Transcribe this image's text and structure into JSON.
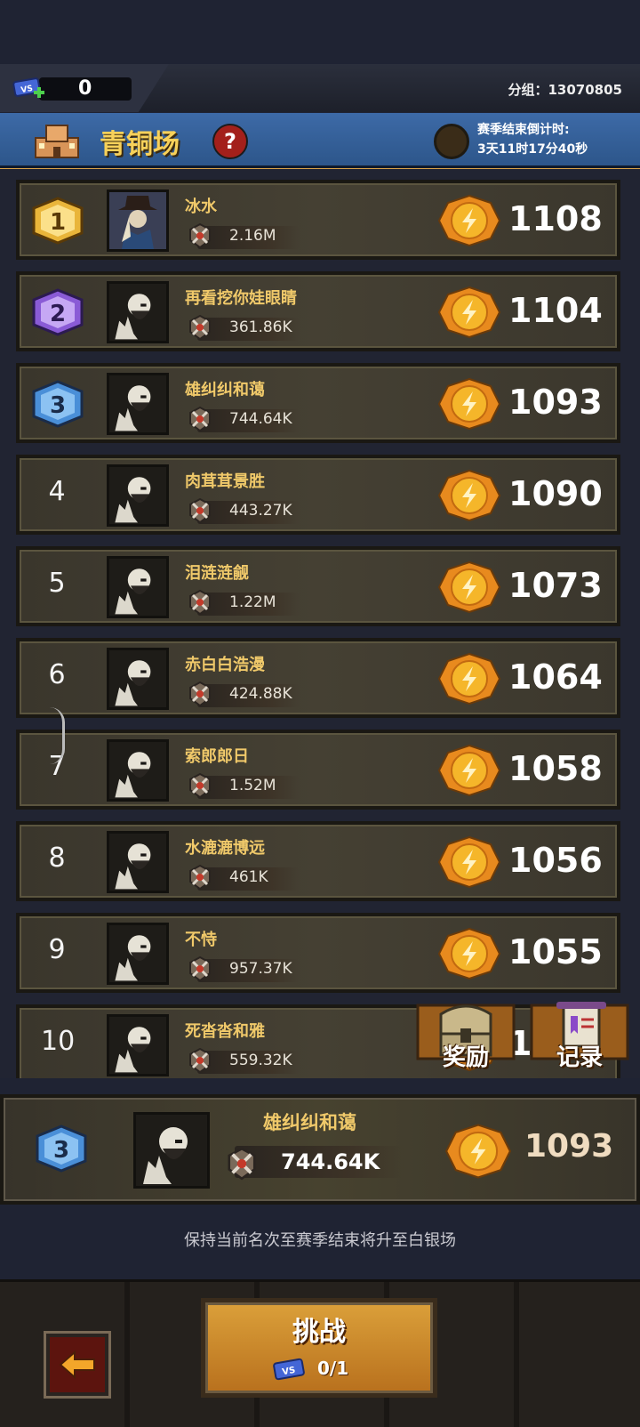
{
  "header": {
    "ticket_count": "0",
    "group_label": "分组：13070805"
  },
  "arena": {
    "title": "青铜场",
    "help": "?",
    "season_label": "赛季结束倒计时:",
    "season_countdown": "3天11时17分40秒"
  },
  "ranking": [
    {
      "rank": "1",
      "name": "冰水",
      "power": "2.16M",
      "score": "1108"
    },
    {
      "rank": "2",
      "name": "再看挖你娃眼睛",
      "power": "361.86K",
      "score": "1104"
    },
    {
      "rank": "3",
      "name": "雄纠纠和蔼",
      "power": "744.64K",
      "score": "1093"
    },
    {
      "rank": "4",
      "name": "肉茸茸景胜",
      "power": "443.27K",
      "score": "1090"
    },
    {
      "rank": "5",
      "name": "泪涟涟觎",
      "power": "1.22M",
      "score": "1073"
    },
    {
      "rank": "6",
      "name": "赤白白浩漫",
      "power": "424.88K",
      "score": "1064"
    },
    {
      "rank": "7",
      "name": "索郎郎日",
      "power": "1.52M",
      "score": "1058"
    },
    {
      "rank": "8",
      "name": "水漉漉博远",
      "power": "461K",
      "score": "1056"
    },
    {
      "rank": "9",
      "name": "不恃",
      "power": "957.37K",
      "score": "1055"
    },
    {
      "rank": "10",
      "name": "死沓沓和雅",
      "power": "559.32K",
      "score": "1047"
    }
  ],
  "buttons": {
    "rewards": "奖励",
    "records": "记录",
    "challenge": "挑战",
    "challenge_cost": "0/1"
  },
  "me": {
    "rank": "3",
    "name": "雄纠纠和蔼",
    "power": "744.64K",
    "score": "1093"
  },
  "hint": "保持当前名次至赛季结束将升至白银场",
  "colors": {
    "gold": "#f0c96a",
    "banner": "#3d6aa7",
    "rank1": "#e9b53a",
    "rank2": "#8a5bd6",
    "rank3": "#4a8fd8"
  }
}
